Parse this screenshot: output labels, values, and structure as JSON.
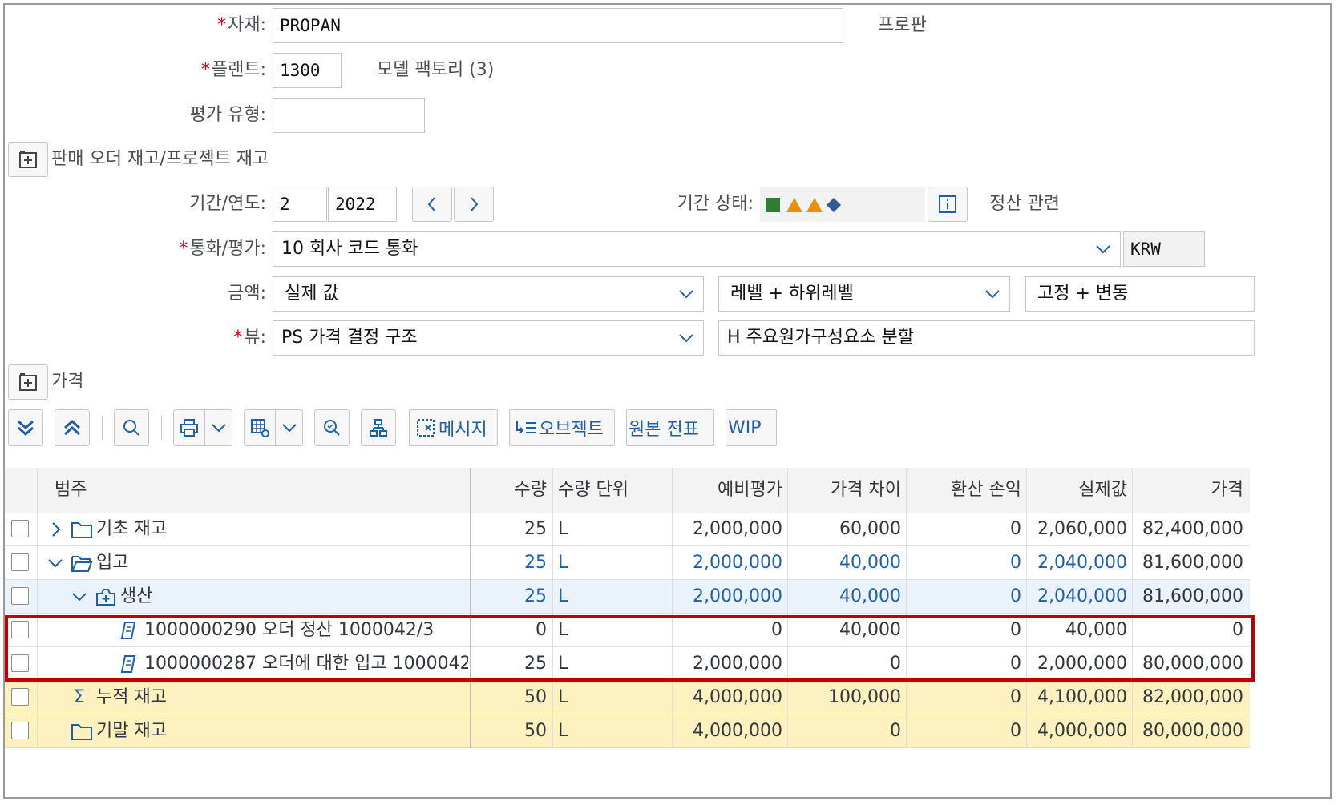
{
  "form": {
    "material_label": "자재:",
    "material_value": "PROPAN",
    "material_desc": "프로판",
    "plant_label": "플랜트:",
    "plant_value": "1300",
    "plant_desc": "모델 팩토리 (3)",
    "valuation_type_label": "평가 유형:",
    "valuation_type_value": "",
    "sales_order_stock_label": "판매 오더 재고/프로젝트 재고",
    "period_label": "기간/연도:",
    "period_value": "2",
    "year_value": "2022",
    "period_status_label": "기간 상태:",
    "settlement_label": "정산 관련",
    "currency_label": "통화/평가:",
    "currency_value": "10 회사 코드 통화",
    "currency_code": "KRW",
    "amount_label": "금액:",
    "amount_value": "실제 값",
    "level_value": "레벨 + 하위레벨",
    "fixvar_value": "고정 + 변동",
    "view_label": "뷰:",
    "view_value": "PS 가격 결정 구조",
    "view2_value": "H 주요원가구성요소 분할",
    "price_section_label": "가격"
  },
  "toolbar": {
    "message_label": "메시지",
    "object_label": "오브젝트",
    "original_doc_label": "원본 전표",
    "wip_label": "WIP"
  },
  "table": {
    "headers": [
      "범주",
      "수량",
      "수량 단위",
      "예비평가",
      "가격 차이",
      "환산 손익",
      "실제값",
      "가격"
    ],
    "rows": [
      {
        "label": "기초 재고",
        "qty": "25",
        "unit": "L",
        "prelim": "2,000,000",
        "pricediff": "60,000",
        "exch": "0",
        "actual": "2,060,000",
        "price": "82,400,000"
      },
      {
        "label": "입고",
        "qty": "25",
        "unit": "L",
        "prelim": "2,000,000",
        "pricediff": "40,000",
        "exch": "0",
        "actual": "2,040,000",
        "price": "81,600,000"
      },
      {
        "label": "생산",
        "qty": "25",
        "unit": "L",
        "prelim": "2,000,000",
        "pricediff": "40,000",
        "exch": "0",
        "actual": "2,040,000",
        "price": "81,600,000"
      },
      {
        "label": "1000000290 오더 정산 1000042/3",
        "qty": "0",
        "unit": "L",
        "prelim": "0",
        "pricediff": "40,000",
        "exch": "0",
        "actual": "40,000",
        "price": "0"
      },
      {
        "label": "1000000287 오더에 대한 입고 1000042",
        "qty": "25",
        "unit": "L",
        "prelim": "2,000,000",
        "pricediff": "0",
        "exch": "0",
        "actual": "2,000,000",
        "price": "80,000,000"
      },
      {
        "label": "누적 재고",
        "qty": "50",
        "unit": "L",
        "prelim": "4,000,000",
        "pricediff": "100,000",
        "exch": "0",
        "actual": "4,100,000",
        "price": "82,000,000"
      },
      {
        "label": "기말 재고",
        "qty": "50",
        "unit": "L",
        "prelim": "4,000,000",
        "pricediff": "0",
        "exch": "0",
        "actual": "4,000,000",
        "price": "80,000,000"
      }
    ]
  },
  "colors": {
    "blue_text": "#1f5fa8",
    "required": "#d0021b",
    "highlight": "#c00000",
    "total_row_bg": "#fdf1c0",
    "selected_row_bg": "#eaf2fb"
  }
}
